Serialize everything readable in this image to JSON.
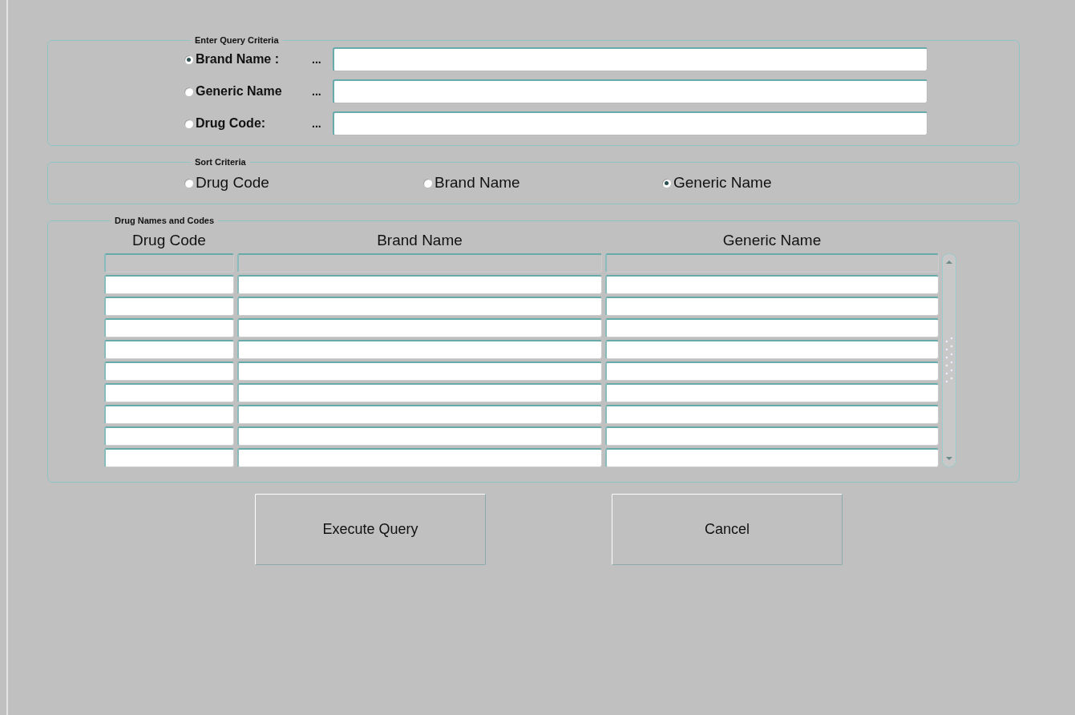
{
  "query_criteria": {
    "title": "Enter Query Criteria",
    "options": [
      {
        "label": "Brand Name :",
        "ellipsis": "...",
        "selected": true
      },
      {
        "label": "Generic Name",
        "ellipsis": "...",
        "selected": false
      },
      {
        "label": "Drug Code:",
        "ellipsis": "...",
        "selected": false
      }
    ]
  },
  "sort_criteria": {
    "title": "Sort Criteria",
    "options": [
      {
        "label": "Drug Code",
        "selected": false
      },
      {
        "label": "Brand Name",
        "selected": false
      },
      {
        "label": "Generic Name",
        "selected": true
      }
    ]
  },
  "drug_table": {
    "title": "Drug Names and Codes",
    "columns": [
      "Drug Code",
      "Brand Name",
      "Generic Name"
    ],
    "rows": [
      {
        "selected": true
      },
      {
        "selected": false
      },
      {
        "selected": false
      },
      {
        "selected": false
      },
      {
        "selected": false
      },
      {
        "selected": false
      },
      {
        "selected": false
      },
      {
        "selected": false
      },
      {
        "selected": false
      },
      {
        "selected": false
      }
    ]
  },
  "buttons": [
    "Execute Query",
    "Cancel"
  ]
}
